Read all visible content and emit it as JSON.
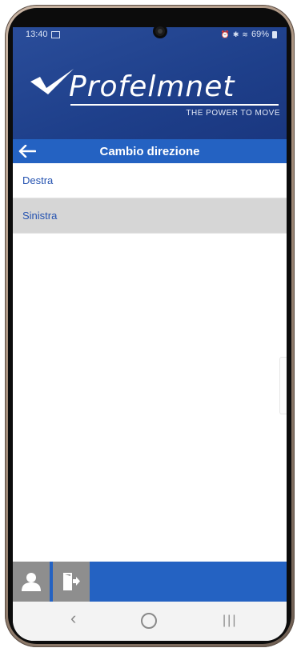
{
  "status_bar": {
    "time": "13:40",
    "battery": "69%"
  },
  "brand": {
    "name": "Profelmnet",
    "tagline": "THE POWER TO MOVE"
  },
  "title_bar": {
    "title": "Cambio direzione",
    "back_icon": "arrow-left-icon"
  },
  "options": [
    {
      "label": "Destra",
      "selected": false
    },
    {
      "label": "Sinistra",
      "selected": true
    }
  ],
  "footer": {
    "user_icon": "user-icon",
    "exit_icon": "exit-icon"
  },
  "colors": {
    "header_blue": "#1e3f8a",
    "title_bar_blue": "#2462c2",
    "option_text": "#2452b0",
    "selected_row": "#d6d6d6",
    "footer_button_gray": "#8e8e8e"
  }
}
